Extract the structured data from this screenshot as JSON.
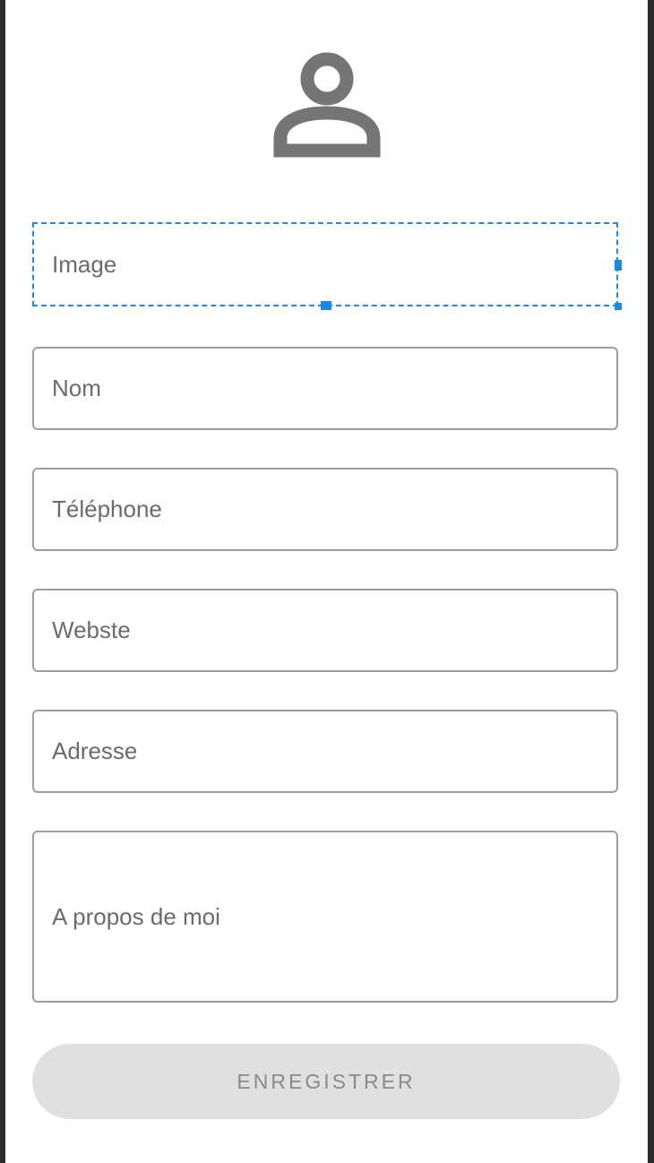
{
  "profile": {
    "avatar_icon": "person-icon",
    "avatar_color": "#757575"
  },
  "form": {
    "image_placeholder": "Image",
    "nom_placeholder": "Nom",
    "telephone_placeholder": "Téléphone",
    "website_placeholder": "Webste",
    "adresse_placeholder": "Adresse",
    "about_placeholder": "A propos de moi",
    "selection_color": "#1e88e5"
  },
  "actions": {
    "save_label": "ENREGISTRER"
  }
}
